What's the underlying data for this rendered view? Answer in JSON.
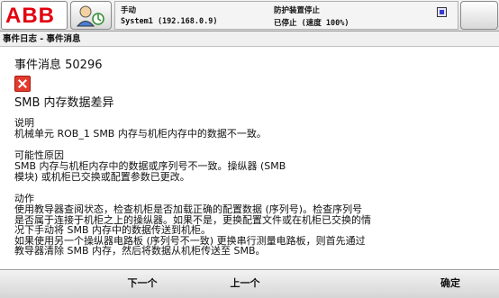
{
  "topbar": {
    "logo_text": "ABB",
    "mode": "手动",
    "system": "System1 (192.168.0.9)",
    "state": "防护装置停止",
    "stop": "已停止 (速度 100%)"
  },
  "breadcrumb": "事件日志 - 事件消息",
  "message": {
    "title": "事件消息 50296",
    "subject": "SMB 内存数据差异",
    "description_label": "说明",
    "description": "机械单元 ROB_1 SMB 内存与机柜内存中的数据不一致。",
    "cause_label": "可能性原因",
    "cause": "SMB 内存与机柜内存中的数据或序列号不一致。操纵器 (SMB\n模块) 或机柜已交换或配置参数已更改。",
    "action_label": "动作",
    "action": "使用教导器查阅状态，检查机柜是否加载正确的配置数据 (序列号)。检查序列号\n是否属于连接于机柜之上的操纵器。如果不是，更换配置文件或在机柜已交换的情\n况下手动将 SMB 内存中的数据传送到机柜。\n如果使用另一个操纵器电路板 (序列号不一致) 更换串行测量电路板，则首先通过\n教导器清除 SMB 内存，然后将数据从机柜传送至 SMB。"
  },
  "buttons": {
    "next": "下一个",
    "prev": "上一个",
    "ok": "确定"
  },
  "colors": {
    "brand": "#e3000f",
    "error": "#e23b2e"
  }
}
